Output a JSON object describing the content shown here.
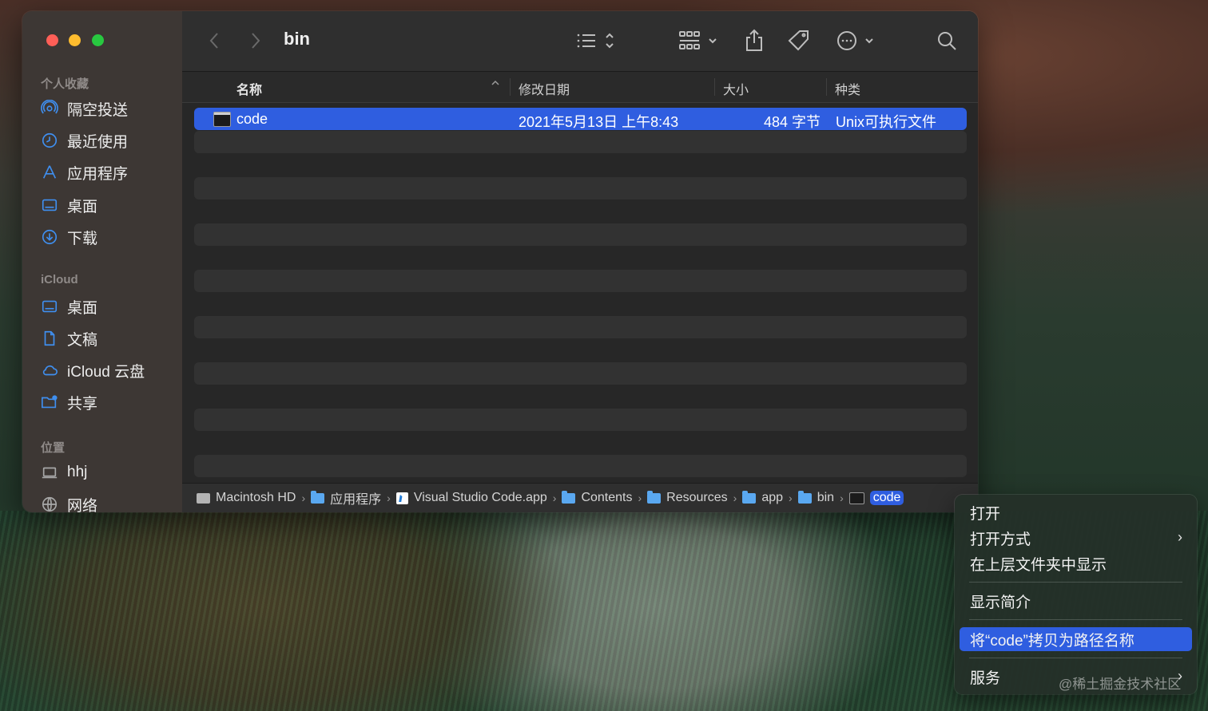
{
  "window": {
    "title": "bin"
  },
  "sidebar": {
    "favorites_heading": "个人收藏",
    "favorites": [
      {
        "label": "隔空投送",
        "icon": "airdrop-icon"
      },
      {
        "label": "最近使用",
        "icon": "clock-icon"
      },
      {
        "label": "应用程序",
        "icon": "applications-icon"
      },
      {
        "label": "桌面",
        "icon": "desktop-icon"
      },
      {
        "label": "下载",
        "icon": "download-icon"
      }
    ],
    "icloud_heading": "iCloud",
    "icloud": [
      {
        "label": "桌面",
        "icon": "desktop-icon"
      },
      {
        "label": "文稿",
        "icon": "document-icon"
      },
      {
        "label": "iCloud 云盘",
        "icon": "cloud-icon"
      },
      {
        "label": "共享",
        "icon": "shared-folder-icon"
      }
    ],
    "locations_heading": "位置",
    "locations": [
      {
        "label": "hhj",
        "icon": "laptop-icon"
      },
      {
        "label": "网络",
        "icon": "network-globe-icon"
      }
    ]
  },
  "columns": {
    "name": "名称",
    "date": "修改日期",
    "size": "大小",
    "kind": "种类"
  },
  "files": [
    {
      "name": "code",
      "date": "2021年5月13日 上午8:43",
      "size": "484 字节",
      "kind": "Unix可执行文件",
      "selected": true
    }
  ],
  "pathbar": [
    {
      "label": "Macintosh HD",
      "icon": "hard-drive-icon"
    },
    {
      "label": "应用程序",
      "icon": "folder-icon"
    },
    {
      "label": "Visual Studio Code.app",
      "icon": "vscode-icon"
    },
    {
      "label": "Contents",
      "icon": "folder-icon"
    },
    {
      "label": "Resources",
      "icon": "folder-icon"
    },
    {
      "label": "app",
      "icon": "folder-icon"
    },
    {
      "label": "bin",
      "icon": "folder-icon"
    },
    {
      "label": "code",
      "icon": "executable-icon"
    }
  ],
  "context_menu": {
    "open": "打开",
    "open_with": "打开方式",
    "show_in_enclosing": "在上层文件夹中显示",
    "get_info": "显示简介",
    "copy_path": "将“code”拷贝为路径名称",
    "services": "服务"
  },
  "watermark": "@稀土掘金技术社区",
  "colors": {
    "accent": "#2f5ee0",
    "sidebar_bg": "#3d3734",
    "window_bg": "#272727"
  }
}
